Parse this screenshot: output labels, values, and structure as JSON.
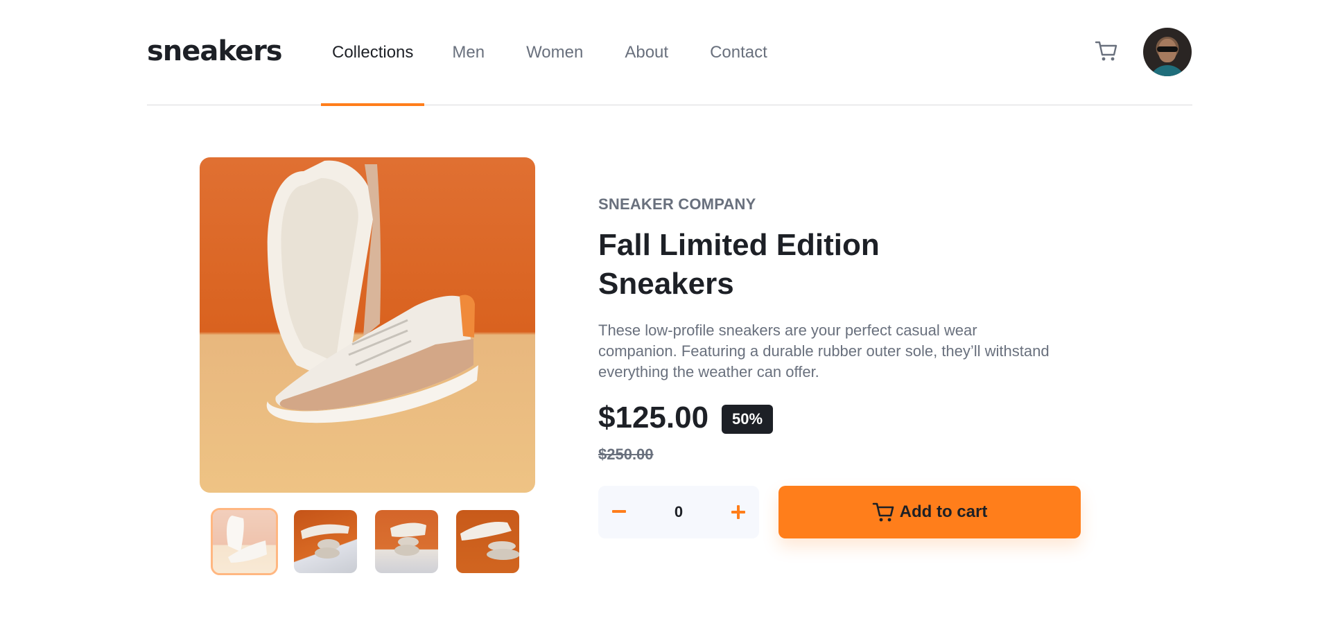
{
  "header": {
    "logo": "sneakers",
    "nav": [
      "Collections",
      "Men",
      "Women",
      "About",
      "Contact"
    ],
    "active_nav": "Collections",
    "cart_icon": "cart-icon",
    "avatar_icon": "avatar"
  },
  "gallery": {
    "main_image": "product-image-1",
    "thumbnails": [
      "thumbnail-1",
      "thumbnail-2",
      "thumbnail-3",
      "thumbnail-4"
    ],
    "selected_thumbnail": 1
  },
  "product": {
    "company": "SNEAKER COMPANY",
    "title": "Fall Limited Edition Sneakers",
    "description": "These low-profile sneakers are your perfect casual wear companion. Featuring a durable rubber outer sole, they’ll withstand everything the weather can offer.",
    "price": "$125.00",
    "discount": "50%",
    "old_price": "$250.00"
  },
  "cart": {
    "quantity": "0",
    "minus_icon": "minus-icon",
    "plus_icon": "plus-icon",
    "add_label": "Add to cart"
  },
  "colors": {
    "accent": "#ff7e1b",
    "dark": "#1d2026",
    "muted": "#69707d",
    "stepper_bg": "#f6f8fd"
  }
}
